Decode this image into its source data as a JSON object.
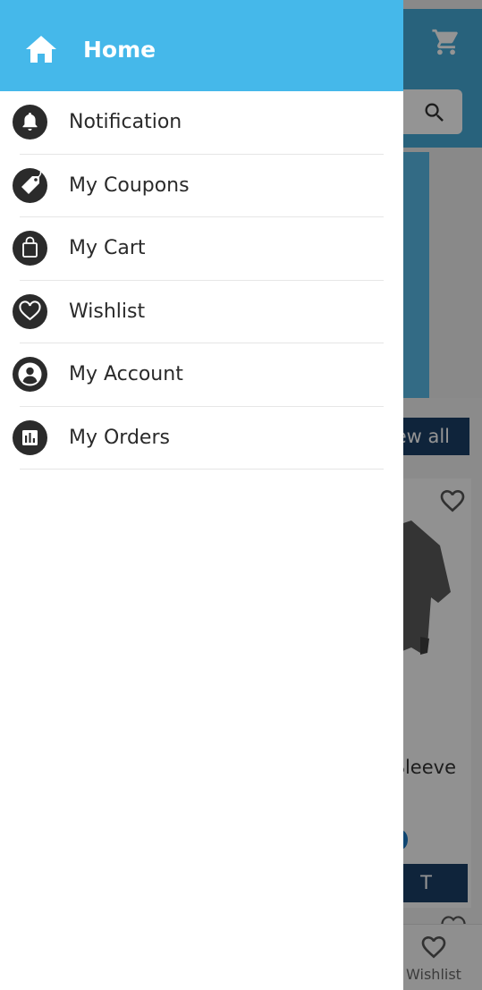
{
  "drawer": {
    "header": {
      "label": "Home",
      "icon": "home-icon"
    },
    "items": [
      {
        "label": "Notification",
        "icon": "bell-icon"
      },
      {
        "label": "My Coupons",
        "icon": "tag-icon"
      },
      {
        "label": "My Cart",
        "icon": "shopping-bag-icon"
      },
      {
        "label": "Wishlist",
        "icon": "heart-icon"
      },
      {
        "label": "My Account",
        "icon": "account-circle-icon"
      },
      {
        "label": "My Orders",
        "icon": "bar-chart-icon"
      }
    ]
  },
  "background": {
    "view_all_fragment": "ew all",
    "product_name_fragment": "Sleeve",
    "add_cart_fragment": "T",
    "bottom_nav_label": "Wishlist"
  },
  "colors": {
    "drawer_header": "#45b8ea",
    "app_bar": "#45a9d6",
    "button_dark": "#1b3f66",
    "icon_circle": "#2b2b2b"
  }
}
